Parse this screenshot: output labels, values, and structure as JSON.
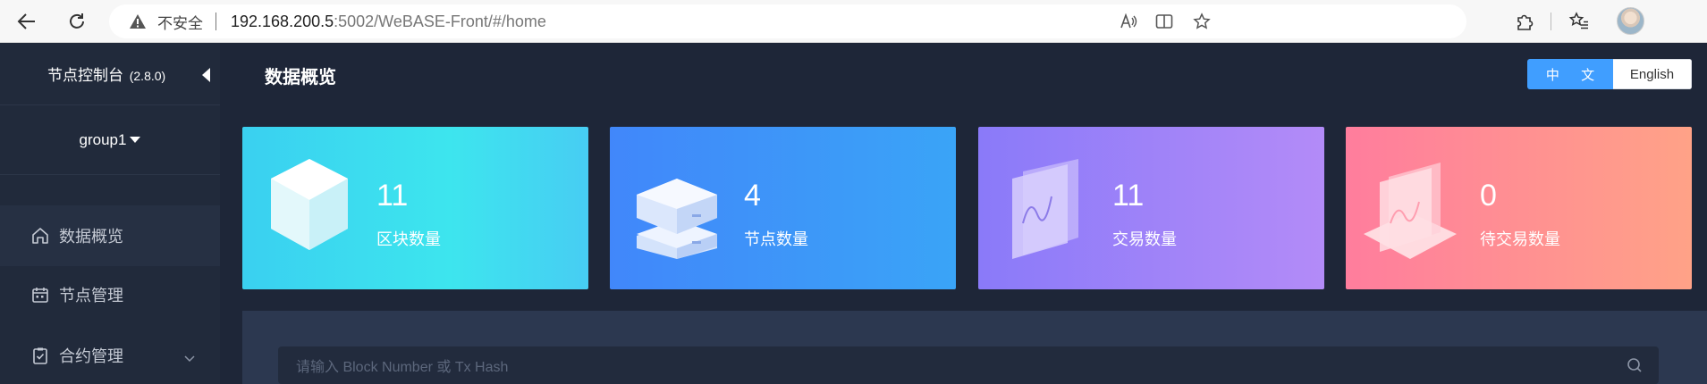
{
  "browser": {
    "insecure_label": "不安全",
    "url_host": "192.168.200.5",
    "url_rest": ":5002/WeBASE-Front/#/home"
  },
  "sidebar": {
    "title": "节点控制台",
    "version": "(2.8.0)",
    "group": "group1",
    "items": [
      {
        "label": "数据概览",
        "icon": "home-icon"
      },
      {
        "label": "节点管理",
        "icon": "calendar-icon"
      },
      {
        "label": "合约管理",
        "icon": "clipboard-check-icon"
      }
    ]
  },
  "main": {
    "title": "数据概览",
    "lang_zh": "中 文",
    "lang_en": "English",
    "cards": [
      {
        "value": "11",
        "label": "区块数量",
        "icon": "cube-icon"
      },
      {
        "value": "4",
        "label": "节点数量",
        "icon": "server-stack-icon"
      },
      {
        "value": "11",
        "label": "交易数量",
        "icon": "transaction-panels-icon"
      },
      {
        "value": "0",
        "label": "待交易数量",
        "icon": "pending-transaction-icon"
      }
    ],
    "search_placeholder": "请输入 Block Number 或 Tx Hash"
  }
}
